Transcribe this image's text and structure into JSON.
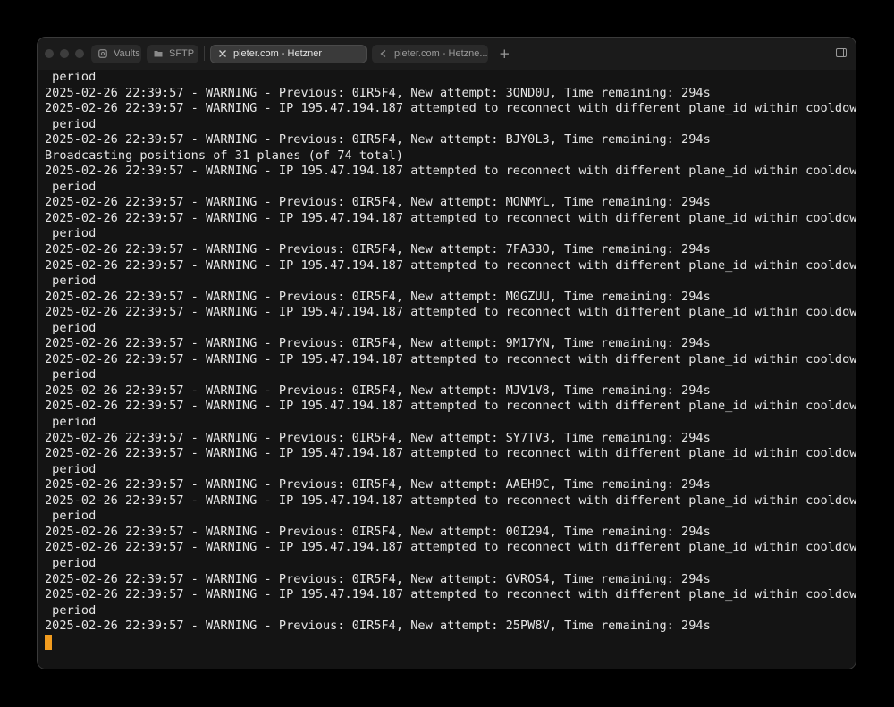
{
  "tabs": [
    {
      "label": "Vaults",
      "icon": "vault-icon",
      "active": false
    },
    {
      "label": "SFTP",
      "icon": "folder-icon",
      "active": false
    },
    {
      "label": "pieter.com - Hetzner",
      "icon": "close-icon",
      "active": true
    },
    {
      "label": "pieter.com - Hetzne...",
      "icon": "terminal-tab-icon",
      "active": false
    }
  ],
  "new_tab_label": "+",
  "cursor_color": "#f29c1f",
  "terminal_lines": [
    " period",
    "2025-02-26 22:39:57 - WARNING - Previous: 0IR5F4, New attempt: 3QND0U, Time remaining: 294s",
    "2025-02-26 22:39:57 - WARNING - IP 195.47.194.187 attempted to reconnect with different plane_id within cooldown",
    " period",
    "2025-02-26 22:39:57 - WARNING - Previous: 0IR5F4, New attempt: BJY0L3, Time remaining: 294s",
    "Broadcasting positions of 31 planes (of 74 total)",
    "2025-02-26 22:39:57 - WARNING - IP 195.47.194.187 attempted to reconnect with different plane_id within cooldown",
    " period",
    "2025-02-26 22:39:57 - WARNING - Previous: 0IR5F4, New attempt: MONMYL, Time remaining: 294s",
    "2025-02-26 22:39:57 - WARNING - IP 195.47.194.187 attempted to reconnect with different plane_id within cooldown",
    " period",
    "2025-02-26 22:39:57 - WARNING - Previous: 0IR5F4, New attempt: 7FA33O, Time remaining: 294s",
    "2025-02-26 22:39:57 - WARNING - IP 195.47.194.187 attempted to reconnect with different plane_id within cooldown",
    " period",
    "2025-02-26 22:39:57 - WARNING - Previous: 0IR5F4, New attempt: M0GZUU, Time remaining: 294s",
    "2025-02-26 22:39:57 - WARNING - IP 195.47.194.187 attempted to reconnect with different plane_id within cooldown",
    " period",
    "2025-02-26 22:39:57 - WARNING - Previous: 0IR5F4, New attempt: 9M17YN, Time remaining: 294s",
    "2025-02-26 22:39:57 - WARNING - IP 195.47.194.187 attempted to reconnect with different plane_id within cooldown",
    " period",
    "2025-02-26 22:39:57 - WARNING - Previous: 0IR5F4, New attempt: MJV1V8, Time remaining: 294s",
    "2025-02-26 22:39:57 - WARNING - IP 195.47.194.187 attempted to reconnect with different plane_id within cooldown",
    " period",
    "2025-02-26 22:39:57 - WARNING - Previous: 0IR5F4, New attempt: SY7TV3, Time remaining: 294s",
    "2025-02-26 22:39:57 - WARNING - IP 195.47.194.187 attempted to reconnect with different plane_id within cooldown",
    " period",
    "2025-02-26 22:39:57 - WARNING - Previous: 0IR5F4, New attempt: AAEH9C, Time remaining: 294s",
    "2025-02-26 22:39:57 - WARNING - IP 195.47.194.187 attempted to reconnect with different plane_id within cooldown",
    " period",
    "2025-02-26 22:39:57 - WARNING - Previous: 0IR5F4, New attempt: 00I294, Time remaining: 294s",
    "2025-02-26 22:39:57 - WARNING - IP 195.47.194.187 attempted to reconnect with different plane_id within cooldown",
    " period",
    "2025-02-26 22:39:57 - WARNING - Previous: 0IR5F4, New attempt: GVROS4, Time remaining: 294s",
    "2025-02-26 22:39:57 - WARNING - IP 195.47.194.187 attempted to reconnect with different plane_id within cooldown",
    " period",
    "2025-02-26 22:39:57 - WARNING - Previous: 0IR5F4, New attempt: 25PW8V, Time remaining: 294s"
  ]
}
